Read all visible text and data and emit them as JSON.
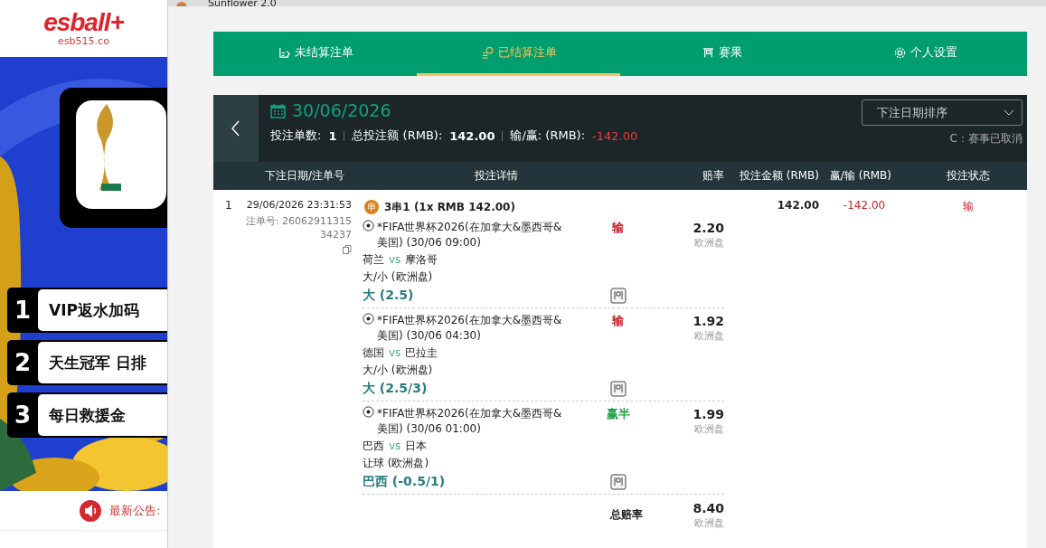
{
  "browser_page": {
    "logo": "esball+",
    "domain": "esb515.co",
    "banner": {
      "kind": "picture",
      "promos": [
        {
          "number": "1",
          "text": "VIP返水加码"
        },
        {
          "number": "2",
          "text": "天生冠军 日排"
        },
        {
          "number": "3",
          "text": "每日救援金"
        }
      ]
    },
    "notice_label": "最新公告:"
  },
  "window": {
    "title": "Sunflower 2.0"
  },
  "tabs": [
    {
      "label": "未结算注单",
      "selected": false
    },
    {
      "label": "已结算注单",
      "selected": true
    },
    {
      "label": "赛果",
      "selected": false
    },
    {
      "label": "个人设置",
      "selected": false
    }
  ],
  "summary": {
    "date": "30/06/2026",
    "count_label": "投注单数:",
    "count": "1",
    "stake_label": "总投注额 (RMB):",
    "stake": "142.00",
    "result_label": "输/赢: (RMB):",
    "result": "-142.00",
    "sort_select": "下注日期排序",
    "legend": "C：赛事已取消"
  },
  "table": {
    "columns": [
      "下注日期/注单号",
      "投注详情",
      "赔率",
      "投注金额 (RMB)",
      "赢/输 (RMB)",
      "投注状态"
    ],
    "rows": [
      {
        "index": "1",
        "datetime": "29/06/2026 23:31:53",
        "bet_no": "注单号: 2606291131534237",
        "bet_type": "3串1 (1x RMB 142.00)",
        "type_badge": "串",
        "stake": "142.00",
        "win_loss": "-142.00",
        "status": "输",
        "legs": [
          {
            "league": "*FIFA世界杯2026(在加拿大&墨西哥&美国) (30/06 09:00)",
            "home": "荷兰",
            "vs": "vs",
            "away": "摩洛哥",
            "market": "大/小 (欧洲盘)",
            "pick": "大 (2.5)",
            "result": "输",
            "color": "#c8202a",
            "odds": "2.20",
            "odds_type": "欧洲盘"
          },
          {
            "league": "*FIFA世界杯2026(在加拿大&墨西哥&美国) (30/06 04:30)",
            "home": "德国",
            "vs": "vs",
            "away": "巴拉圭",
            "market": "大/小 (欧洲盘)",
            "pick": "大 (2.5/3)",
            "result": "输",
            "color": "#c8202a",
            "odds": "1.92",
            "odds_type": "欧洲盘"
          },
          {
            "league": "*FIFA世界杯2026(在加拿大&墨西哥&美国) (30/06 01:00)",
            "home": "巴西",
            "vs": "vs",
            "away": "日本",
            "market": "让球 (欧洲盘)",
            "pick": "巴西 (-0.5/1)",
            "result": "赢半",
            "color": "#27a14a",
            "odds": "1.99",
            "odds_type": "欧洲盘"
          }
        ],
        "total_label": "总赔率",
        "total_odds": "8.40",
        "total_odds_type": "欧洲盘"
      }
    ]
  }
}
